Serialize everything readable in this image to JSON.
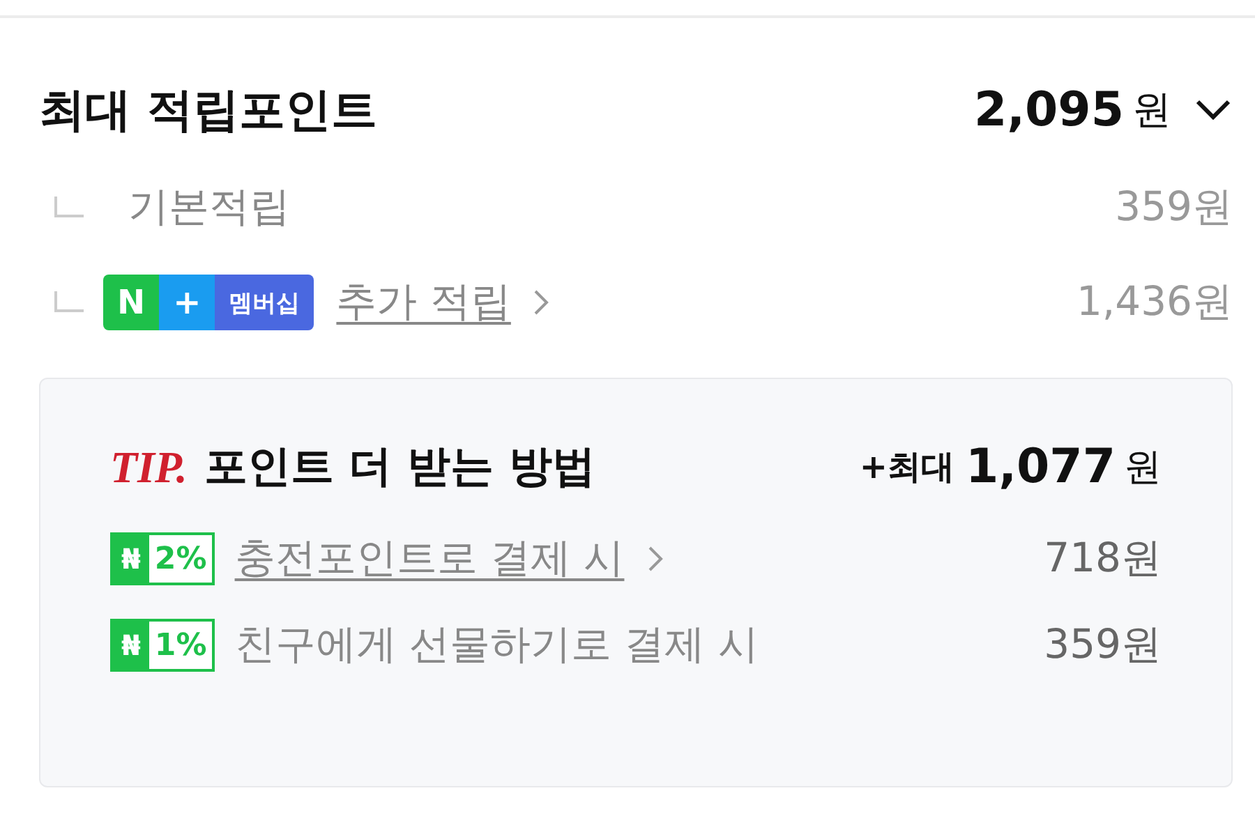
{
  "header": {
    "title": "최대 적립포인트",
    "amount": "2,095",
    "unit": "원"
  },
  "rows": [
    {
      "kind": "basic",
      "label": "기본적립",
      "amount": "359원"
    },
    {
      "kind": "membership",
      "badge": {
        "logo": "N",
        "plus": "+",
        "text": "멤버십"
      },
      "label": "추가 적립",
      "link": true,
      "amount": "1,436원"
    }
  ],
  "tip": {
    "mark": "TIP.",
    "title": "포인트 더 받는 방법",
    "bonus_prefix": "+최대",
    "bonus_amount": "1,077",
    "bonus_unit": "원",
    "items": [
      {
        "logo": "₦",
        "percent": "2%",
        "label": "충전포인트로 결제 시",
        "link": true,
        "amount": "718원"
      },
      {
        "logo": "₦",
        "percent": "1%",
        "label": "친구에게 선물하기로 결제 시",
        "link": false,
        "amount": "359원"
      }
    ]
  }
}
